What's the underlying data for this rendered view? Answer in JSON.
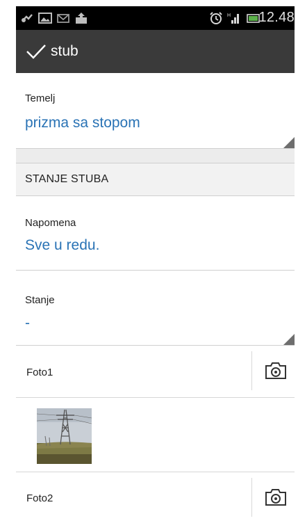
{
  "status_bar": {
    "time": "12.48",
    "icons": [
      "usb-debug-icon",
      "image-icon",
      "mail-icon",
      "upload-icon",
      "alarm-icon",
      "signal-icon",
      "battery-icon"
    ]
  },
  "action_bar": {
    "title": "stub",
    "icon": "check-icon"
  },
  "fields": [
    {
      "label": "Temelj",
      "value": "prizma sa stopom"
    }
  ],
  "section": {
    "title": "STANJE STUBA"
  },
  "section_fields": [
    {
      "label": "Napomena",
      "value": "Sve u redu."
    },
    {
      "label": "Stanje",
      "value": "-"
    }
  ],
  "photos": [
    {
      "label": "Foto1",
      "icon": "camera-icon",
      "selected": true,
      "has_thumbnail": true
    },
    {
      "label": "Foto2",
      "icon": "camera-icon",
      "selected": false,
      "has_thumbnail": false
    }
  ],
  "colors": {
    "accent": "#2f7bbf",
    "value_text": "#2a73b5",
    "action_bar": "#3a3a3a"
  }
}
